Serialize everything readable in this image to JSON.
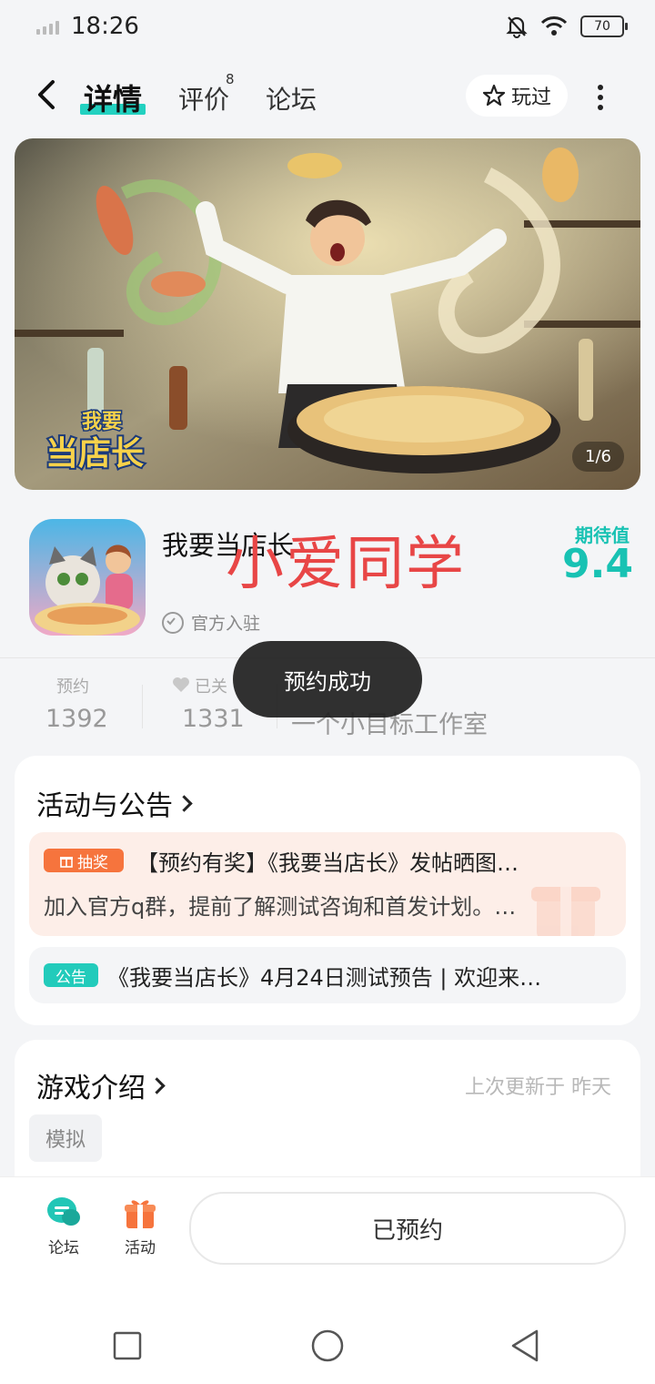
{
  "status_bar": {
    "time": "18:26",
    "battery": "70"
  },
  "nav": {
    "tabs": [
      {
        "label": "详情"
      },
      {
        "label": "评价",
        "count": "8"
      },
      {
        "label": "论坛"
      }
    ],
    "played_label": "玩过"
  },
  "banner": {
    "counter": "1/6",
    "logo_text": "我要当店长"
  },
  "game": {
    "title": "我要当店长",
    "official_label": "官方入驻",
    "expect_label": "期待值",
    "expect_value": "9.4",
    "watermark": "小爱同学"
  },
  "stats": [
    {
      "label": "预约",
      "value": "1392"
    },
    {
      "label": "已关",
      "value": "1331"
    },
    {
      "label": "",
      "value": "一个小目标工作室"
    }
  ],
  "toast": "预约成功",
  "activities": {
    "title": "活动与公告",
    "lottery_badge": "抽奖",
    "lottery_title": "【预约有奖】《我要当店长》发帖晒图…",
    "lottery_desc": "加入官方q群，提前了解测试咨询和首发计划。…",
    "notice_badge": "公告",
    "notice_text": "《我要当店长》4月24日测试预告 | 欢迎来…"
  },
  "intro": {
    "title": "游戏介绍",
    "update_text": "上次更新于 昨天",
    "tag": "模拟"
  },
  "bottom_bar": {
    "forum_label": "论坛",
    "activity_label": "活动",
    "reserved_label": "已预约"
  },
  "colors": {
    "accent": "#22d1c0",
    "expect": "#18c2b3",
    "lottery": "#f6743d",
    "watermark": "#e84646"
  }
}
